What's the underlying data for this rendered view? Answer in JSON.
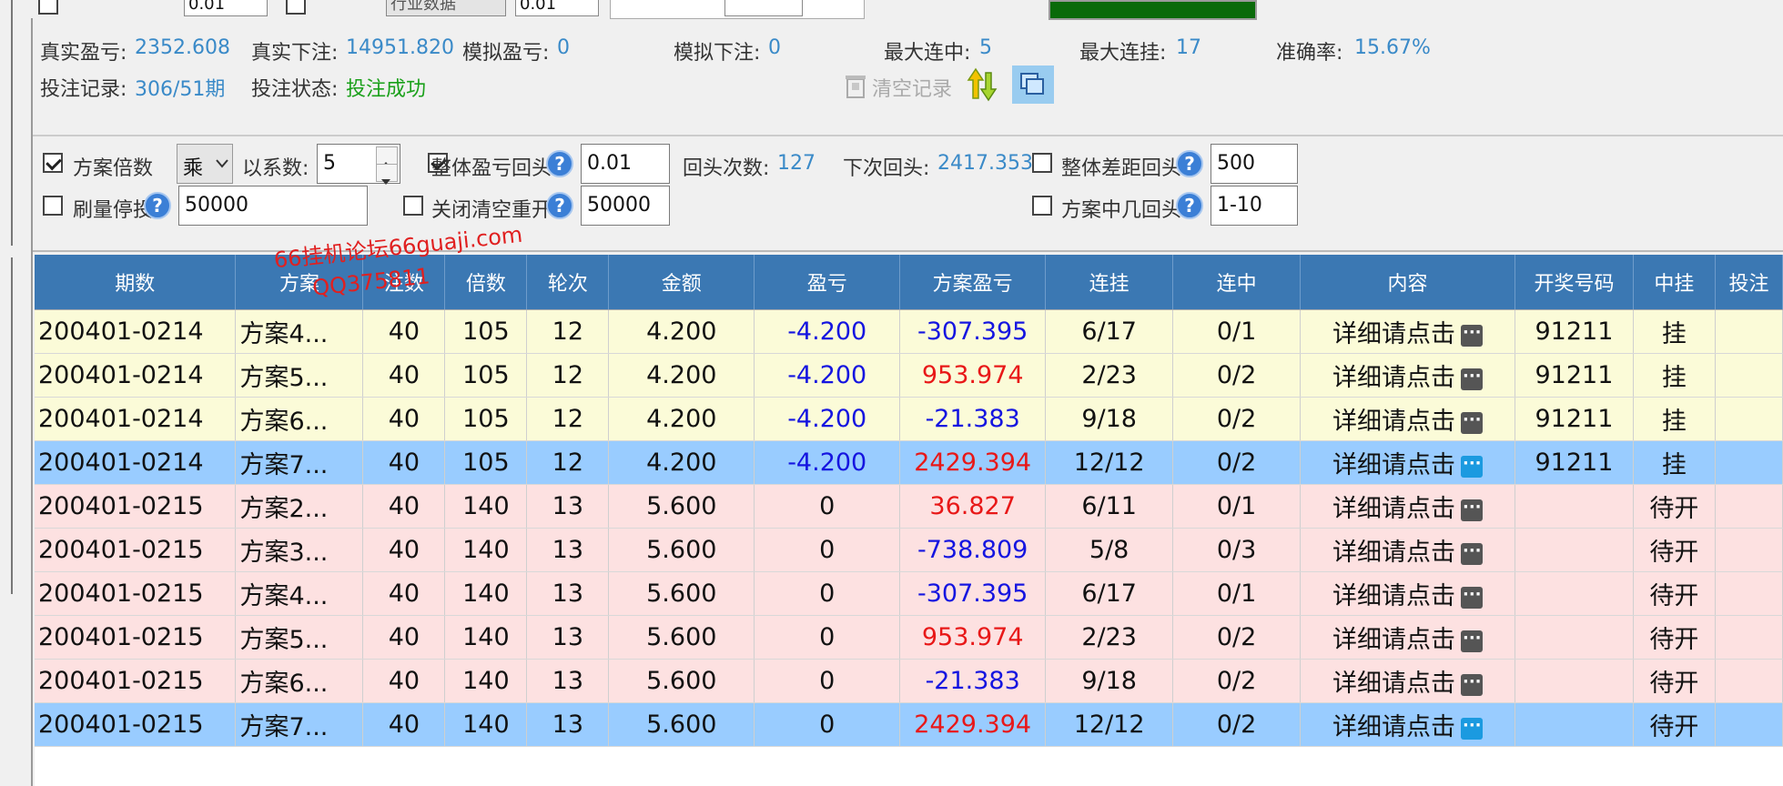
{
  "topbar": {
    "field1_value": "0.01",
    "field2_value": "行业数据",
    "field3_value": "0.01"
  },
  "stats": {
    "real_pnl_label": "真实盈亏:",
    "real_pnl_value": "2352.608",
    "real_bet_label": "真实下注:",
    "real_bet_value": "14951.820",
    "sim_pnl_label": "模拟盈亏:",
    "sim_pnl_value": "0",
    "sim_bet_label": "模拟下注:",
    "sim_bet_value": "0",
    "max_win_streak_label": "最大连中:",
    "max_win_streak_value": "5",
    "max_loss_streak_label": "最大连挂:",
    "max_loss_streak_value": "17",
    "accuracy_label": "准确率:",
    "accuracy_value": "15.67%",
    "bet_record_label": "投注记录:",
    "bet_record_value": "306/51期",
    "bet_status_label": "投注状态:",
    "bet_status_value": "投注成功",
    "clear_label": "清空记录"
  },
  "options": {
    "plan_multiple_label": "方案倍数",
    "operator_value": "乘",
    "coef_label": "以系数:",
    "coef_value": "5",
    "overall_pnl_label": "整体盈亏回头",
    "overall_pnl_value": "0.01",
    "rewind_count_label": "回头次数:",
    "rewind_count_value": "127",
    "next_rewind_label": "下次回头:",
    "next_rewind_value": "2417.353",
    "overall_gap_label": "整体差距回头",
    "overall_gap_value": "500",
    "volume_stop_label": "刷量停投",
    "volume_stop_value": "50000",
    "close_clear_label": "关闭清空重开",
    "close_clear_value": "50000",
    "plan_hit_label": "方案中几回头",
    "plan_hit_value": "1-10"
  },
  "watermark": {
    "line1": "66挂机论坛66guaji.com",
    "line2": "QQ375811"
  },
  "grid": {
    "columns": [
      "期数",
      "方案",
      "注数",
      "倍数",
      "轮次",
      "金额",
      "盈亏",
      "方案盈亏",
      "连挂",
      "连中",
      "内容",
      "开奖号码",
      "中挂",
      "投注"
    ],
    "detail_text": "详细请点击",
    "rows": [
      {
        "style": "y",
        "period": "200401-0214",
        "plan": "方案4...",
        "notes": "40",
        "mult": "105",
        "round": "12",
        "amount": "4.200",
        "pnl": "-4.200",
        "plan_pnl": "-307.395",
        "loss_streak": "6/17",
        "win_streak": "0/1",
        "draw": "91211",
        "result": "挂"
      },
      {
        "style": "y",
        "period": "200401-0214",
        "plan": "方案5...",
        "notes": "40",
        "mult": "105",
        "round": "12",
        "amount": "4.200",
        "pnl": "-4.200",
        "plan_pnl": "953.974",
        "loss_streak": "2/23",
        "win_streak": "0/2",
        "draw": "91211",
        "result": "挂"
      },
      {
        "style": "y",
        "period": "200401-0214",
        "plan": "方案6...",
        "notes": "40",
        "mult": "105",
        "round": "12",
        "amount": "4.200",
        "pnl": "-4.200",
        "plan_pnl": "-21.383",
        "loss_streak": "9/18",
        "win_streak": "0/2",
        "draw": "91211",
        "result": "挂"
      },
      {
        "style": "b",
        "period": "200401-0214",
        "plan": "方案7...",
        "notes": "40",
        "mult": "105",
        "round": "12",
        "amount": "4.200",
        "pnl": "-4.200",
        "plan_pnl": "2429.394",
        "loss_streak": "12/12",
        "win_streak": "0/2",
        "draw": "91211",
        "result": "挂"
      },
      {
        "style": "p",
        "period": "200401-0215",
        "plan": "方案2...",
        "notes": "40",
        "mult": "140",
        "round": "13",
        "amount": "5.600",
        "pnl": "0",
        "plan_pnl": "36.827",
        "loss_streak": "6/11",
        "win_streak": "0/1",
        "draw": "",
        "result": "待开"
      },
      {
        "style": "p",
        "period": "200401-0215",
        "plan": "方案3...",
        "notes": "40",
        "mult": "140",
        "round": "13",
        "amount": "5.600",
        "pnl": "0",
        "plan_pnl": "-738.809",
        "loss_streak": "5/8",
        "win_streak": "0/3",
        "draw": "",
        "result": "待开"
      },
      {
        "style": "p",
        "period": "200401-0215",
        "plan": "方案4...",
        "notes": "40",
        "mult": "140",
        "round": "13",
        "amount": "5.600",
        "pnl": "0",
        "plan_pnl": "-307.395",
        "loss_streak": "6/17",
        "win_streak": "0/1",
        "draw": "",
        "result": "待开"
      },
      {
        "style": "p",
        "period": "200401-0215",
        "plan": "方案5...",
        "notes": "40",
        "mult": "140",
        "round": "13",
        "amount": "5.600",
        "pnl": "0",
        "plan_pnl": "953.974",
        "loss_streak": "2/23",
        "win_streak": "0/2",
        "draw": "",
        "result": "待开"
      },
      {
        "style": "p",
        "period": "200401-0215",
        "plan": "方案6...",
        "notes": "40",
        "mult": "140",
        "round": "13",
        "amount": "5.600",
        "pnl": "0",
        "plan_pnl": "-21.383",
        "loss_streak": "9/18",
        "win_streak": "0/2",
        "draw": "",
        "result": "待开"
      },
      {
        "style": "b",
        "period": "200401-0215",
        "plan": "方案7...",
        "notes": "40",
        "mult": "140",
        "round": "13",
        "amount": "5.600",
        "pnl": "0",
        "plan_pnl": "2429.394",
        "loss_streak": "12/12",
        "win_streak": "0/2",
        "draw": "",
        "result": "待开"
      }
    ]
  }
}
